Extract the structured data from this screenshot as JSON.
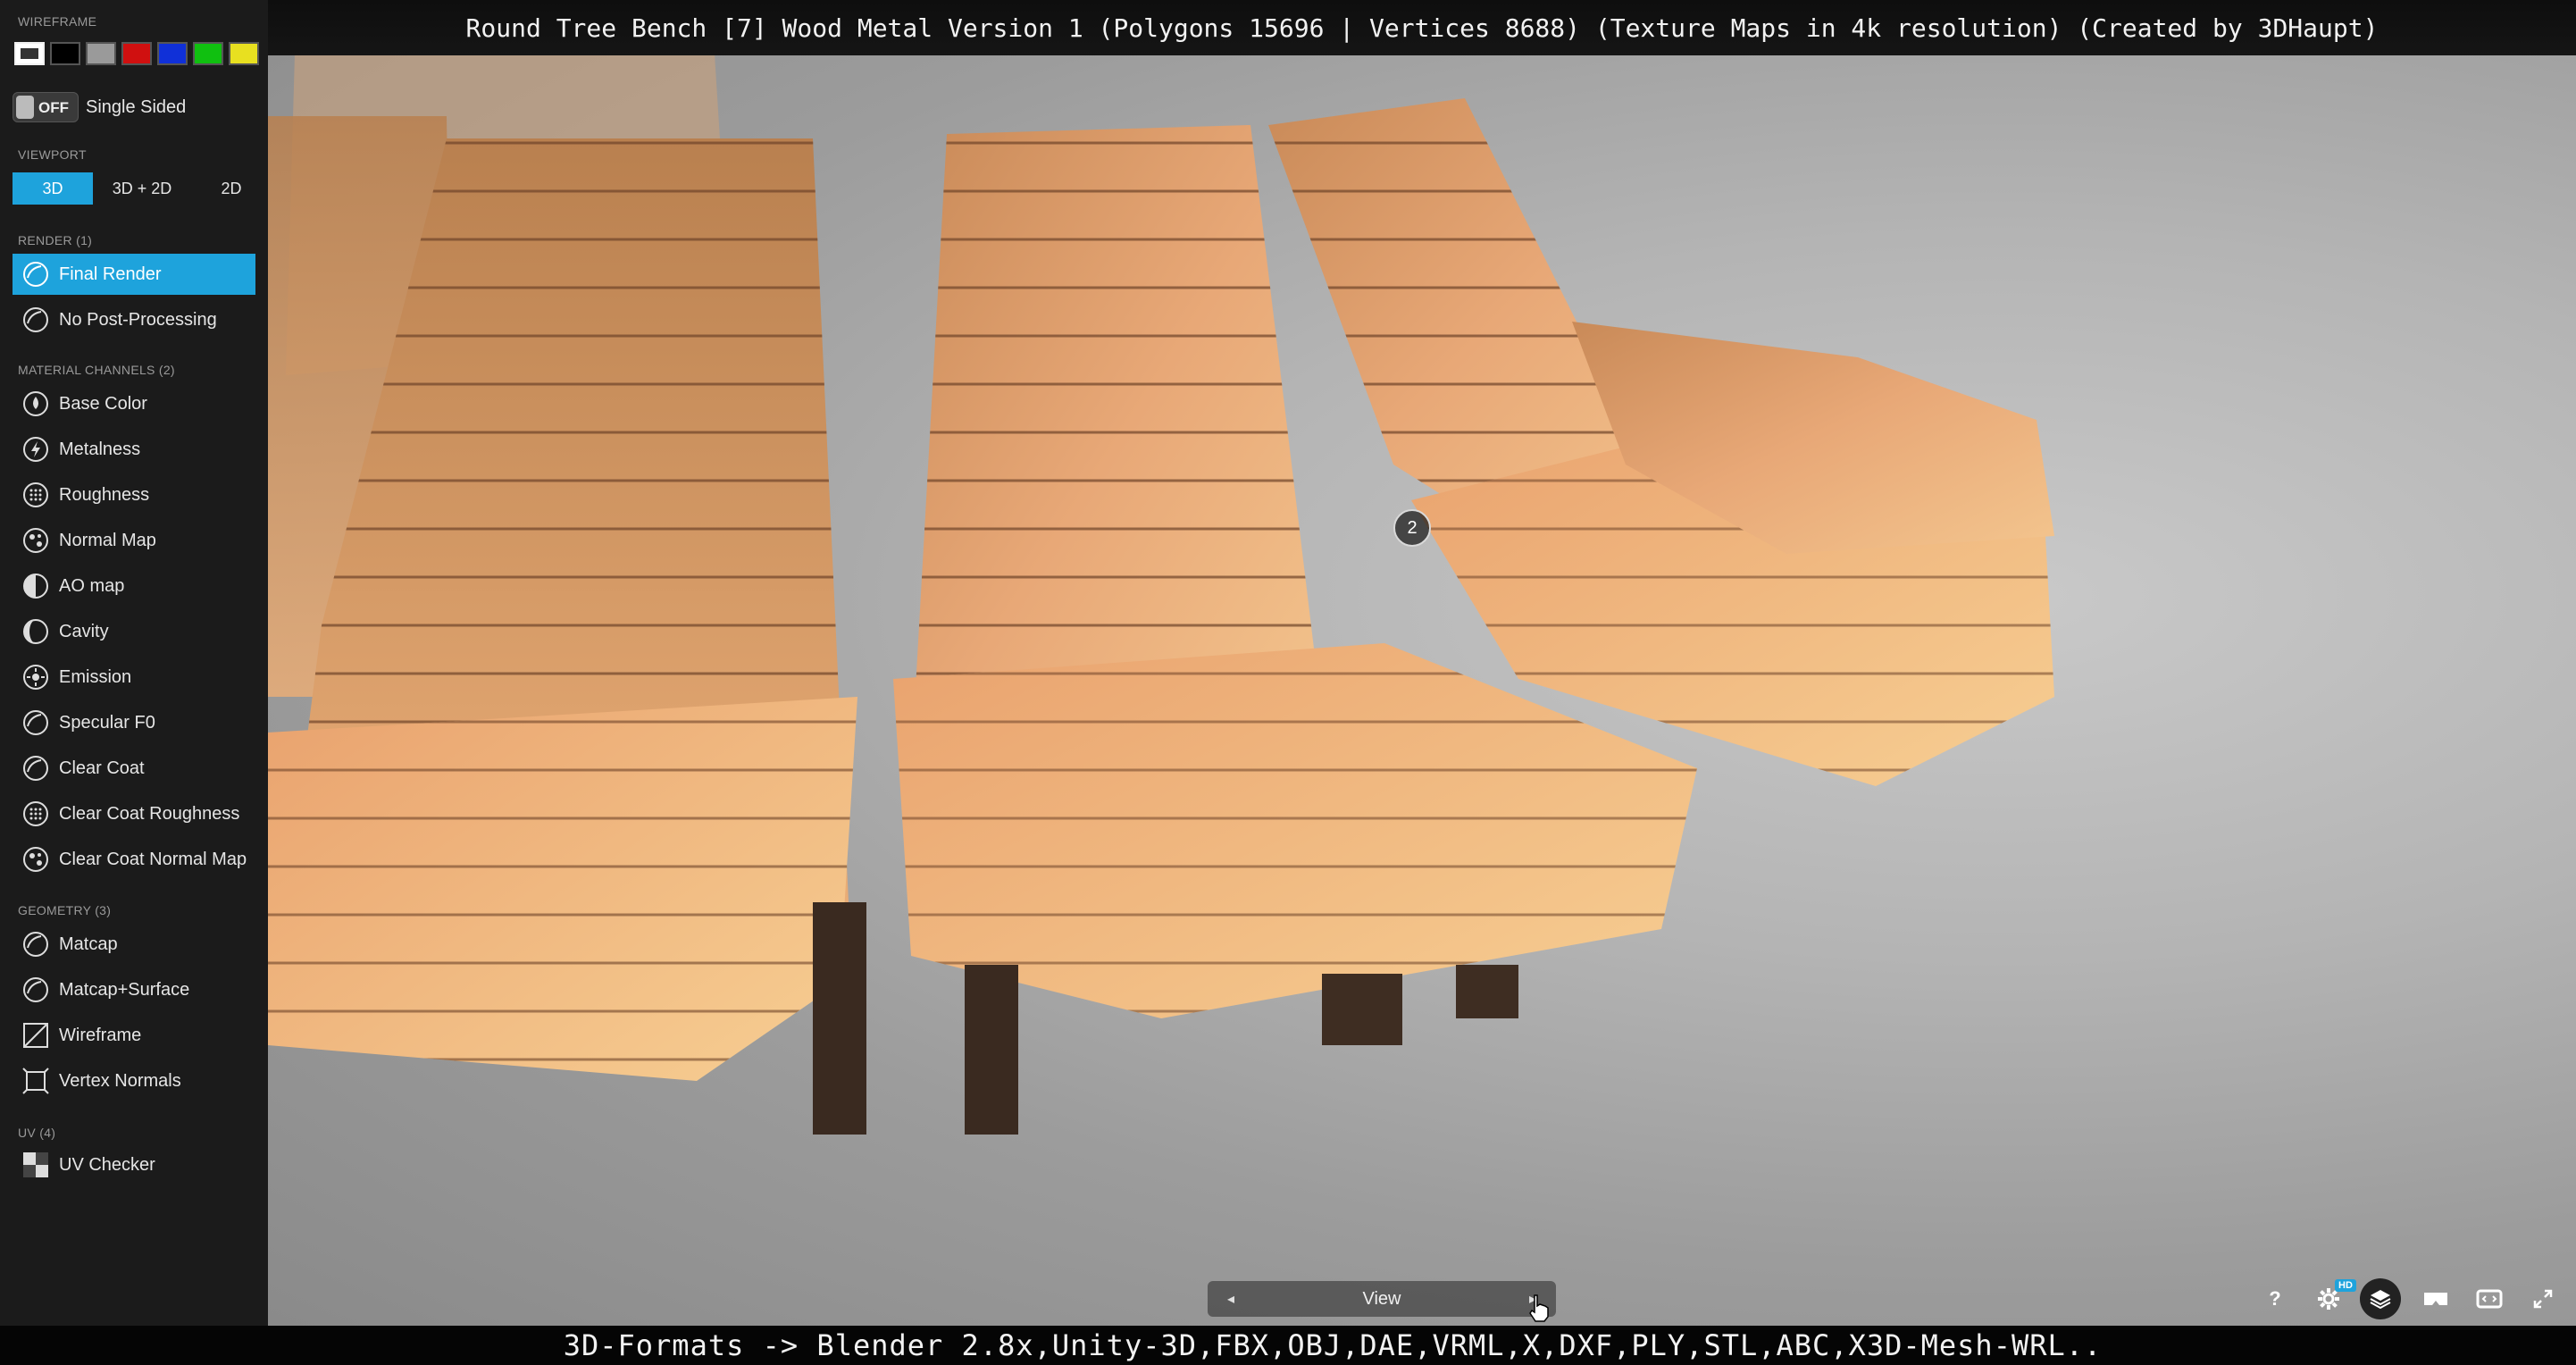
{
  "title_bar": {
    "text": "Round Tree Bench [7] Wood Metal Version 1 (Polygons 15696 | Vertices 8688) (Texture Maps in 4k resolution) (Created by 3DHaupt)"
  },
  "bottom_caption": {
    "text": "3D-Formats -> Blender 2.8x,Unity-3D,FBX,OBJ,DAE,VRML,X,DXF,PLY,STL,ABC,X3D-Mesh-WRL.."
  },
  "sidebar": {
    "wireframe_label": "WIREFRAME",
    "wireframe_colors": [
      "#ffffff",
      "#000000",
      "#9a9a9a",
      "#d01010",
      "#1030d8",
      "#10c010",
      "#e8e020"
    ],
    "single_sided": {
      "state": "OFF",
      "label": "Single Sided"
    },
    "viewport_label": "VIEWPORT",
    "viewport_tabs": [
      "3D",
      "3D + 2D",
      "2D"
    ],
    "viewport_active": "3D",
    "render_label": "RENDER (1)",
    "render_items": [
      "Final Render",
      "No Post-Processing"
    ],
    "material_label": "MATERIAL CHANNELS (2)",
    "material_items": [
      "Base Color",
      "Metalness",
      "Roughness",
      "Normal Map",
      "AO map",
      "Cavity",
      "Emission",
      "Specular F0",
      "Clear Coat",
      "Clear Coat Roughness",
      "Clear Coat Normal Map"
    ],
    "geometry_label": "GEOMETRY (3)",
    "geometry_items": [
      "Matcap",
      "Matcap+Surface",
      "Wireframe",
      "Vertex Normals"
    ],
    "uv_label": "UV (4)",
    "uv_items": [
      "UV Checker"
    ]
  },
  "viewer": {
    "hotspot_number": "2",
    "view_nav_label": "View",
    "controls": [
      "help-icon",
      "settings-icon",
      "layers-icon",
      "vr-icon",
      "embed-icon",
      "fullscreen-icon"
    ],
    "hd_badge": "HD",
    "help_glyph": "?"
  },
  "colors": {
    "accent": "#1ea3dc",
    "sidebar_bg": "#1b1b1b",
    "wood": "#e6a06a"
  }
}
